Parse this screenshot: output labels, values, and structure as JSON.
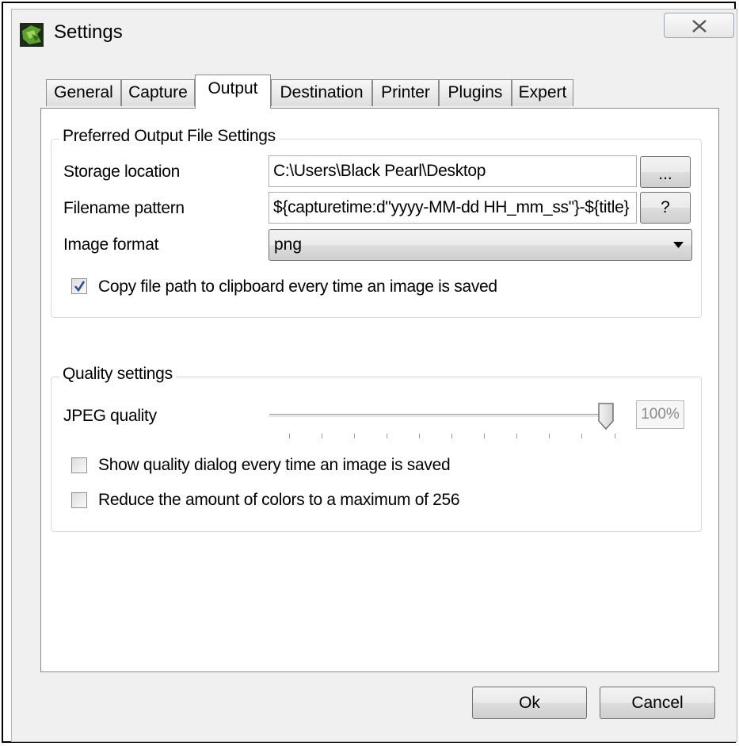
{
  "window": {
    "title": "Settings",
    "app_icon": "greenshot-icon",
    "close_icon": "close-icon"
  },
  "tabs": [
    {
      "label": "General",
      "active": false
    },
    {
      "label": "Capture",
      "active": false
    },
    {
      "label": "Output",
      "active": true
    },
    {
      "label": "Destination",
      "active": false
    },
    {
      "label": "Printer",
      "active": false
    },
    {
      "label": "Plugins",
      "active": false
    },
    {
      "label": "Expert",
      "active": false
    }
  ],
  "output": {
    "group_title": "Preferred Output File Settings",
    "storage_label": "Storage location",
    "storage_value": "C:\\Users\\Black Pearl\\Desktop",
    "browse_button": "...",
    "filename_label": "Filename pattern",
    "filename_value": "${capturetime:d\"yyyy-MM-dd HH_mm_ss\"}-${title}",
    "help_button": "?",
    "format_label": "Image format",
    "format_value": "png",
    "copy_path_label": "Copy file path to clipboard every time an image is saved",
    "copy_path_checked": true
  },
  "quality": {
    "group_title": "Quality settings",
    "jpeg_label": "JPEG quality",
    "jpeg_value": 100,
    "jpeg_display": "100%",
    "show_dialog_label": "Show quality dialog every time an image is saved",
    "show_dialog_checked": false,
    "reduce_colors_label": "Reduce the amount of colors to a maximum of 256",
    "reduce_colors_checked": false
  },
  "footer": {
    "ok_label": "Ok",
    "cancel_label": "Cancel"
  }
}
